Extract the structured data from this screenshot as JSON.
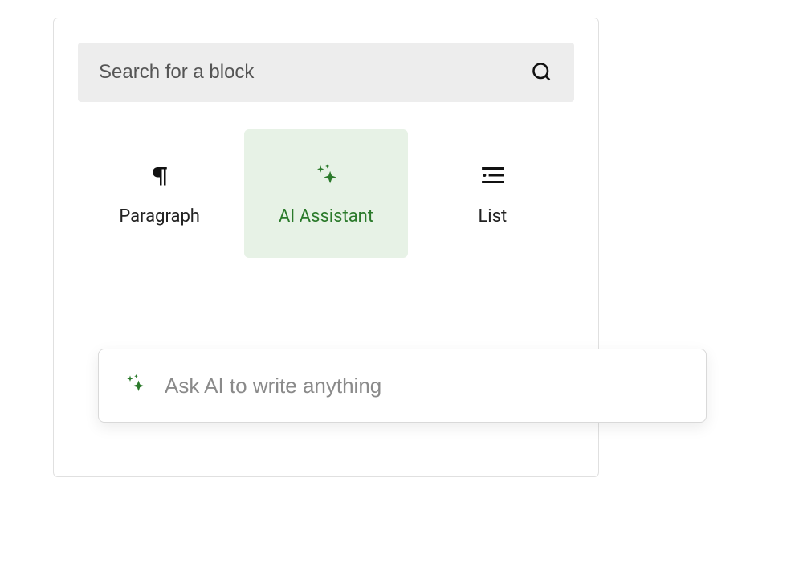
{
  "colors": {
    "accent_green": "#2b7a2b",
    "selected_bg": "#e7f2e6"
  },
  "search": {
    "placeholder": "Search for a block"
  },
  "blocks": [
    {
      "label": "Paragraph",
      "icon": "pilcrow",
      "selected": false
    },
    {
      "label": "AI Assistant",
      "icon": "sparkle",
      "selected": true
    },
    {
      "label": "List",
      "icon": "list",
      "selected": false
    }
  ],
  "ai_bar": {
    "placeholder": "Ask AI to write anything"
  }
}
